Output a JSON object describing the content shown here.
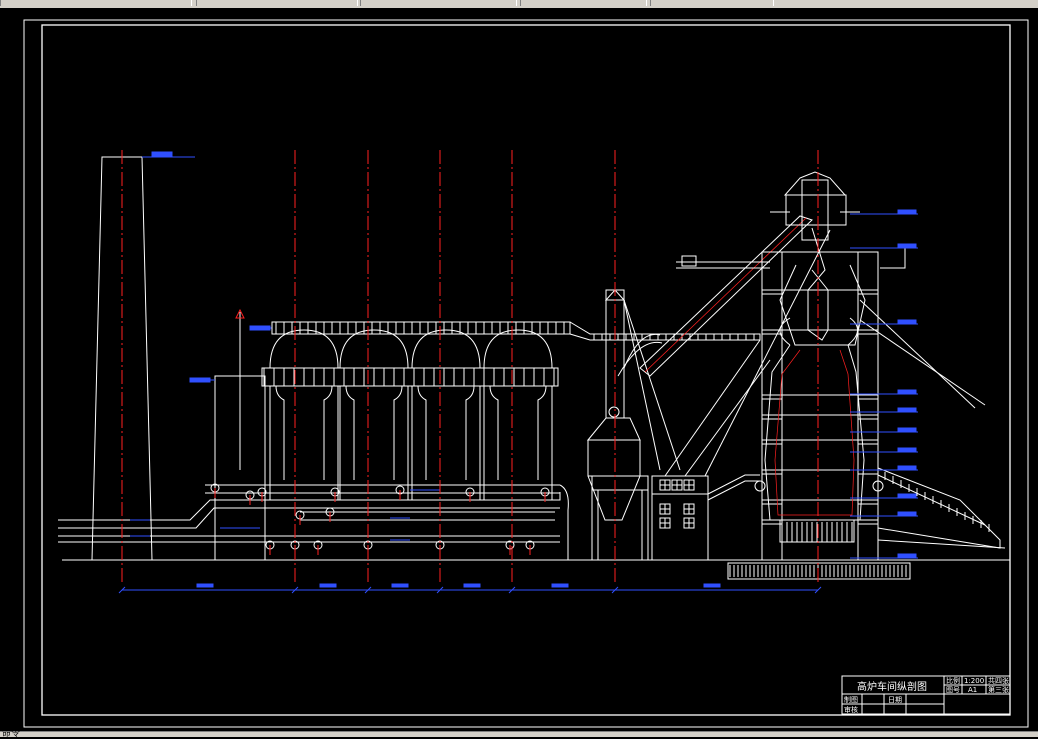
{
  "title_block": {
    "title": "高炉车间纵剖图",
    "scale_label": "比例",
    "scale_value": "1:200",
    "total_sheets": "共四张",
    "drawing_no_label": "图号",
    "drawing_no_value": "A1",
    "sheet_label": "第三张",
    "drawn_label": "制图",
    "checked_label": "审核",
    "date_label": "日期"
  },
  "colors": {
    "background": "#000000",
    "lines": "#ffffff",
    "axis": "#ff2020",
    "dimension": "#3050ff"
  },
  "status": {
    "prompt": "命令"
  }
}
